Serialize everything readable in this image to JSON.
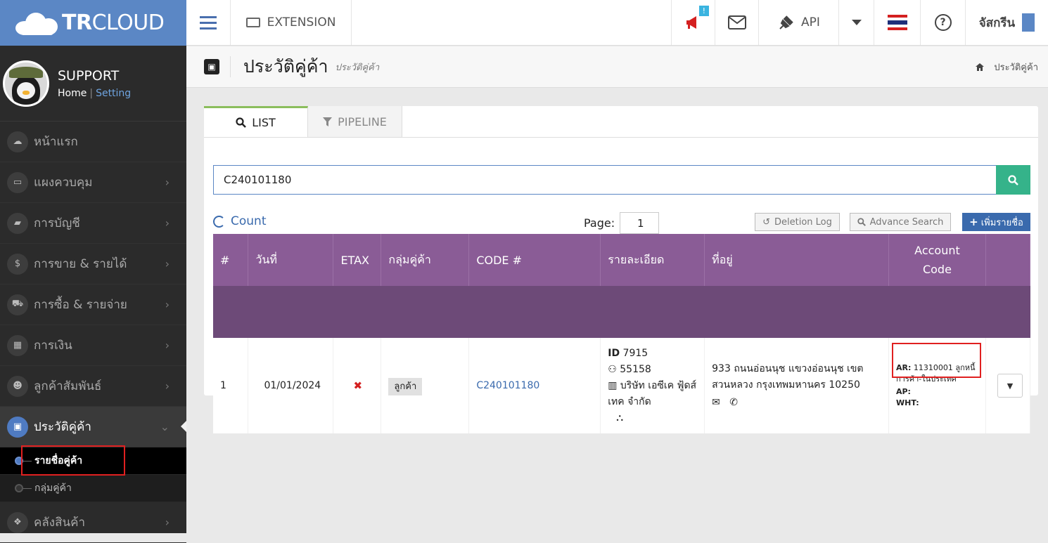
{
  "brand": {
    "bold": "TR",
    "rest": "CLOUD"
  },
  "profile": {
    "name": "SUPPORT",
    "home": "Home",
    "separator": "|",
    "setting": "Setting"
  },
  "menu": [
    {
      "icon": "cloud-icon",
      "glyph": "☁",
      "label": "หน้าแรก",
      "chevron": ""
    },
    {
      "icon": "monitor-icon",
      "glyph": "▭",
      "label": "แผงควบคุม",
      "chevron": "›"
    },
    {
      "icon": "book-icon",
      "glyph": "▰",
      "label": "การบัญชี",
      "chevron": "›"
    },
    {
      "icon": "dollar-icon",
      "glyph": "$",
      "label": "การขาย & รายได้",
      "chevron": "›"
    },
    {
      "icon": "cart-icon",
      "glyph": "⛟",
      "label": "การซื้อ & รายจ่าย",
      "chevron": "›"
    },
    {
      "icon": "calendar-icon",
      "glyph": "▦",
      "label": "การเงิน",
      "chevron": "›"
    },
    {
      "icon": "users-icon",
      "glyph": "☻",
      "label": "ลูกค้าสัมพันธ์",
      "chevron": "›"
    },
    {
      "icon": "contact-icon",
      "glyph": "▣",
      "label": "ประวัติคู่ค้า",
      "chevron": "⌄"
    },
    {
      "icon": "boxes-icon",
      "glyph": "❖",
      "label": "คลังสินค้า",
      "chevron": "›"
    }
  ],
  "submenu": [
    {
      "label": "รายชื่อคู่ค้า"
    },
    {
      "label": "กลุ่มคู่ค้า"
    }
  ],
  "topbar": {
    "extension": "EXTENSION",
    "badge": "!",
    "api": "API",
    "user": "จัสกรีน"
  },
  "page": {
    "title": "ประวัติคู่ค้า",
    "subtitle": "ประวัติคู่ค้า",
    "breadcrumb": "ประวัติคู่ค้า"
  },
  "tabs": {
    "list": "LIST",
    "pipeline": "PIPELINE"
  },
  "search": {
    "value": "C240101180"
  },
  "controls": {
    "count": "Count",
    "page_label": "Page:",
    "page_value": "1",
    "deletion_log": "Deletion Log",
    "advance_search": "Advance Search",
    "add": "เพิ่มรายชื่อ"
  },
  "table": {
    "headers": [
      "#",
      "วันที่",
      "ETAX",
      "กลุ่มคู่ค้า",
      "CODE #",
      "รายละเอียด",
      "ที่อยู่",
      "Account Code",
      ""
    ],
    "row": {
      "num": "1",
      "date": "01/01/2024",
      "etax": "✖",
      "group": "ลูกค้า",
      "code": "C240101180",
      "detail_id_label": "ID",
      "detail_id": "7915",
      "detail_user": "55158",
      "detail_company": "บริษัท เอซีเค ฟู้ดส์เทค จำกัด",
      "address": "933 ถนนอ่อนนุช แขวงอ่อนนุช เขตสวนหลวง กรุงเทพมหานคร 10250",
      "ar_label": "AR:",
      "ar_value": "11310001 ลูกหนี้การค้า-ในประเทศ",
      "ap_label": "AP:",
      "wht_label": "WHT:"
    }
  },
  "colors": {
    "brand": "#5b87c5",
    "table_header": "#8a5c96",
    "search_btn": "#35b38a",
    "highlight": "#e02020"
  }
}
